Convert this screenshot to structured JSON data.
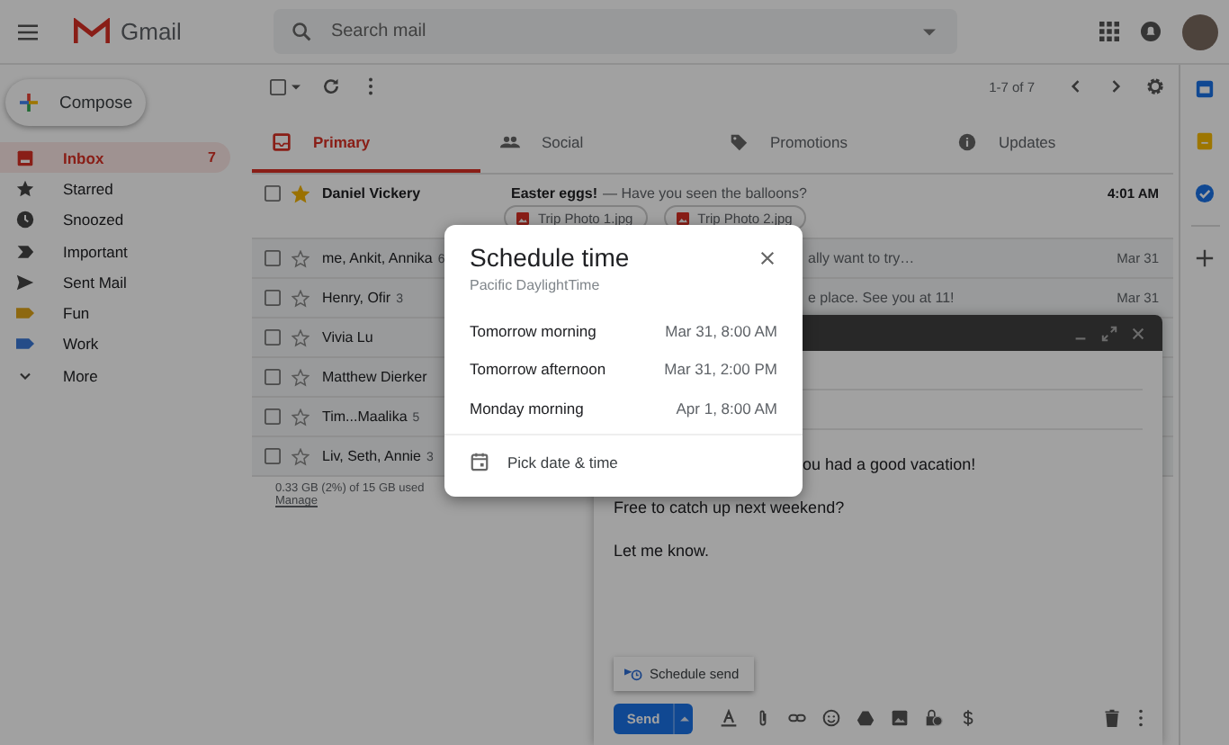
{
  "header": {
    "app_name": "Gmail",
    "search": {
      "placeholder": "Search mail"
    }
  },
  "compose_button": "Compose",
  "sidebar": {
    "items": [
      {
        "label": "Inbox",
        "count": "7",
        "selected": true,
        "kind": "inbox"
      },
      {
        "label": "Starred",
        "selected": false,
        "kind": "star"
      },
      {
        "label": "Snoozed",
        "selected": false,
        "kind": "clock"
      },
      {
        "label": "Important",
        "selected": false,
        "kind": "important"
      },
      {
        "label": "Sent Mail",
        "selected": false,
        "kind": "sent"
      },
      {
        "label": "Fun",
        "selected": false,
        "kind": "label",
        "color": "#8d6810"
      },
      {
        "label": "Work",
        "selected": false,
        "kind": "label",
        "color": "#254c88"
      },
      {
        "label": "More",
        "selected": false,
        "kind": "more"
      }
    ]
  },
  "toolbar": {
    "select_all_checked": false,
    "pagination": "1-7 of 7"
  },
  "tabs": [
    {
      "label": "Primary",
      "selected": true,
      "kind": "inbox"
    },
    {
      "label": "Social",
      "selected": false,
      "kind": "people"
    },
    {
      "label": "Promotions",
      "selected": false,
      "kind": "tag"
    },
    {
      "label": "Updates",
      "selected": false,
      "kind": "info"
    }
  ],
  "emails": [
    {
      "sender": "Daniel Vickery",
      "selected": false,
      "starred": true,
      "unread": true,
      "covered": false,
      "subject": "Easter eggs!",
      "snippet": "— Have you seen the balloons?",
      "date": "4:01 AM",
      "attachments": [
        "Trip Photo 1.jpg",
        "Trip Photo 2.jpg"
      ]
    },
    {
      "sender": "me, Ankit, Annika",
      "count": "6",
      "selected": false,
      "starred": false,
      "unread": false,
      "covered": true,
      "snippet": "ally want to try…",
      "date": "Mar 31"
    },
    {
      "sender": "Henry, Ofir",
      "count": "3",
      "selected": false,
      "starred": false,
      "unread": false,
      "covered": true,
      "snippet": "e place. See you at 11!",
      "date": "Mar 31"
    },
    {
      "sender": "Vivia Lu",
      "selected": false,
      "starred": false,
      "unread": false
    },
    {
      "sender": "Matthew Dierker",
      "selected": false,
      "starred": false,
      "unread": false
    },
    {
      "sender": "Tim...Maalika",
      "count": "5",
      "selected": false,
      "starred": false,
      "unread": false
    },
    {
      "sender": "Liv, Seth, Annie",
      "count": "3",
      "selected": false,
      "starred": false,
      "unread": false
    }
  ],
  "storage": {
    "usage": "0.33 GB (2%) of 15 GB used",
    "link": "Manage"
  },
  "compose": {
    "body": [
      {
        "text": "ou had a good vacation!",
        "covered": true
      },
      {
        "text": "Free to catch up next weekend?",
        "covered": false
      },
      {
        "text": "Let me know.",
        "covered": false
      }
    ],
    "schedule_send": "Schedule send",
    "send": "Send"
  },
  "schedule_dialog": {
    "title": "Schedule time",
    "timezone": "Pacific DaylightTime",
    "options": [
      {
        "label": "Tomorrow morning",
        "time": "Mar 31, 8:00 AM"
      },
      {
        "label": "Tomorrow afternoon",
        "time": "Mar 31, 2:00 PM"
      },
      {
        "label": "Monday morning",
        "time": "Apr 1, 8:00 AM"
      }
    ],
    "custom": "Pick date & time"
  }
}
